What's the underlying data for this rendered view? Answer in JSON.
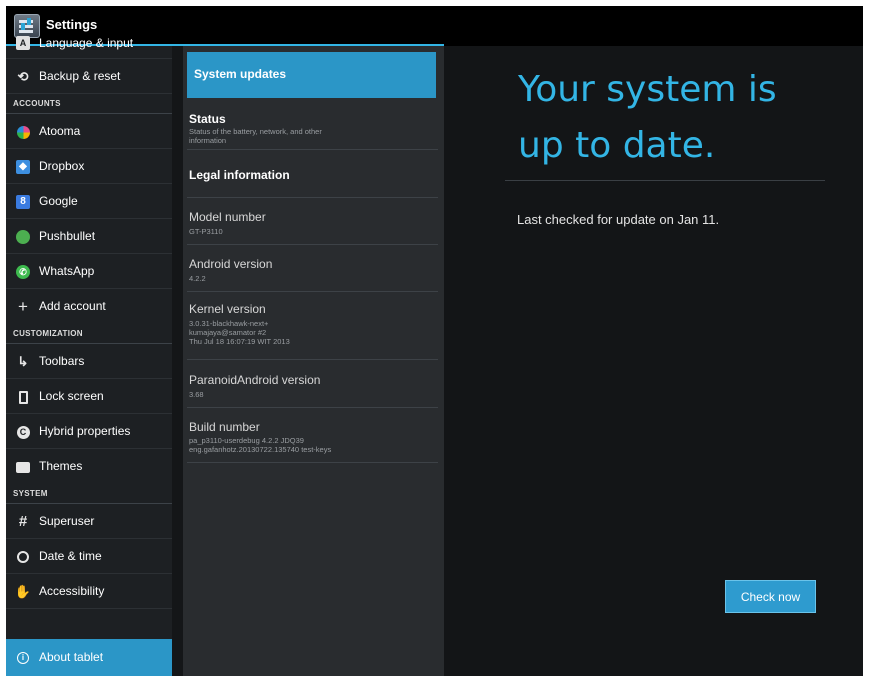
{
  "app": {
    "title": "Settings",
    "icon": "settings-icon",
    "accent": "#33b5e5"
  },
  "sidebar": {
    "items": [
      {
        "label": "Language & input",
        "icon": "language-icon"
      },
      {
        "label": "Backup & reset",
        "icon": "backup-icon"
      },
      {
        "section": "ACCOUNTS"
      },
      {
        "label": "Atooma",
        "icon": "atooma-icon"
      },
      {
        "label": "Dropbox",
        "icon": "dropbox-icon"
      },
      {
        "label": "Google",
        "icon": "google-icon"
      },
      {
        "label": "Pushbullet",
        "icon": "pushbullet-icon"
      },
      {
        "label": "WhatsApp",
        "icon": "whatsapp-icon"
      },
      {
        "label": "Add account",
        "icon": "plus-icon"
      },
      {
        "section": "CUSTOMIZATION"
      },
      {
        "label": "Toolbars",
        "icon": "toolbars-icon"
      },
      {
        "label": "Lock screen",
        "icon": "lock-screen-icon"
      },
      {
        "label": "Hybrid properties",
        "icon": "hybrid-icon"
      },
      {
        "label": "Themes",
        "icon": "themes-icon"
      },
      {
        "section": "SYSTEM"
      },
      {
        "label": "Superuser",
        "icon": "superuser-icon"
      },
      {
        "label": "Date & time",
        "icon": "clock-icon"
      },
      {
        "label": "Accessibility",
        "icon": "accessibility-icon"
      },
      {
        "label": "About tablet",
        "icon": "info-icon",
        "active": true
      }
    ]
  },
  "about": {
    "rows": [
      {
        "title": "System updates",
        "selected": true
      },
      {
        "title": "Status",
        "summary": "Status of the battery, network, and other\ninformation"
      },
      {
        "title": "Legal information"
      },
      {
        "title": "Model number",
        "summary": "GT-P3110"
      },
      {
        "title": "Android version",
        "summary": "4.2.2"
      },
      {
        "title": "Kernel version",
        "summary": "3.0.31-blackhawk-next+\nkumajaya@samator #2\nThu Jul 18 16:07:19 WIT 2013"
      },
      {
        "title": "ParanoidAndroid version",
        "summary": "3.68"
      },
      {
        "title": "Build number",
        "summary": "pa_p3110-userdebug 4.2.2 JDQ39\neng.gafanhotz.20130722.135740 test-keys"
      }
    ]
  },
  "update": {
    "headline_1": "Your system is",
    "headline_2": "up to date.",
    "last_checked": "Last checked for update on Jan 11.",
    "check_button": "Check now"
  }
}
